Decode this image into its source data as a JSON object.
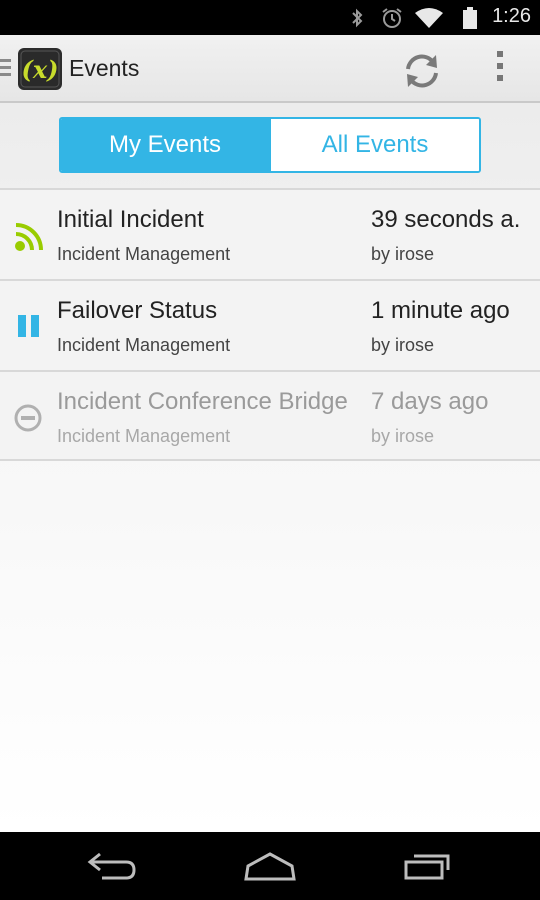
{
  "status_bar": {
    "time": "1:26",
    "icons": [
      "bluetooth-icon",
      "alarm-icon",
      "wifi-icon",
      "battery-icon"
    ]
  },
  "action_bar": {
    "title": "Events",
    "logo_text": "(x)",
    "actions": [
      "refresh-icon",
      "overflow-menu-icon"
    ]
  },
  "tabs": [
    {
      "label": "My Events",
      "selected": true
    },
    {
      "label": "All Events",
      "selected": false
    }
  ],
  "events": [
    {
      "name": "Initial Incident",
      "group": "Incident Management",
      "time": "39 seconds a.",
      "by": "by irose",
      "status_icon": "broadcast-icon",
      "status_color": "#99cc00"
    },
    {
      "name": "Failover Status",
      "group": "Incident Management",
      "time": "1 minute ago",
      "by": "by irose",
      "status_icon": "pause-icon",
      "status_color": "#33b5e5"
    },
    {
      "name": "Incident Conference Bridge",
      "group": "Incident Management",
      "time": "7 days ago",
      "by": "by irose",
      "status_icon": "terminated-icon",
      "status_color": "#b0b0b0"
    }
  ],
  "nav_bar": [
    "back-icon",
    "home-icon",
    "recent-apps-icon"
  ],
  "colors": {
    "accent": "#33b5e5",
    "logo_yellow": "#c8dc2c"
  }
}
